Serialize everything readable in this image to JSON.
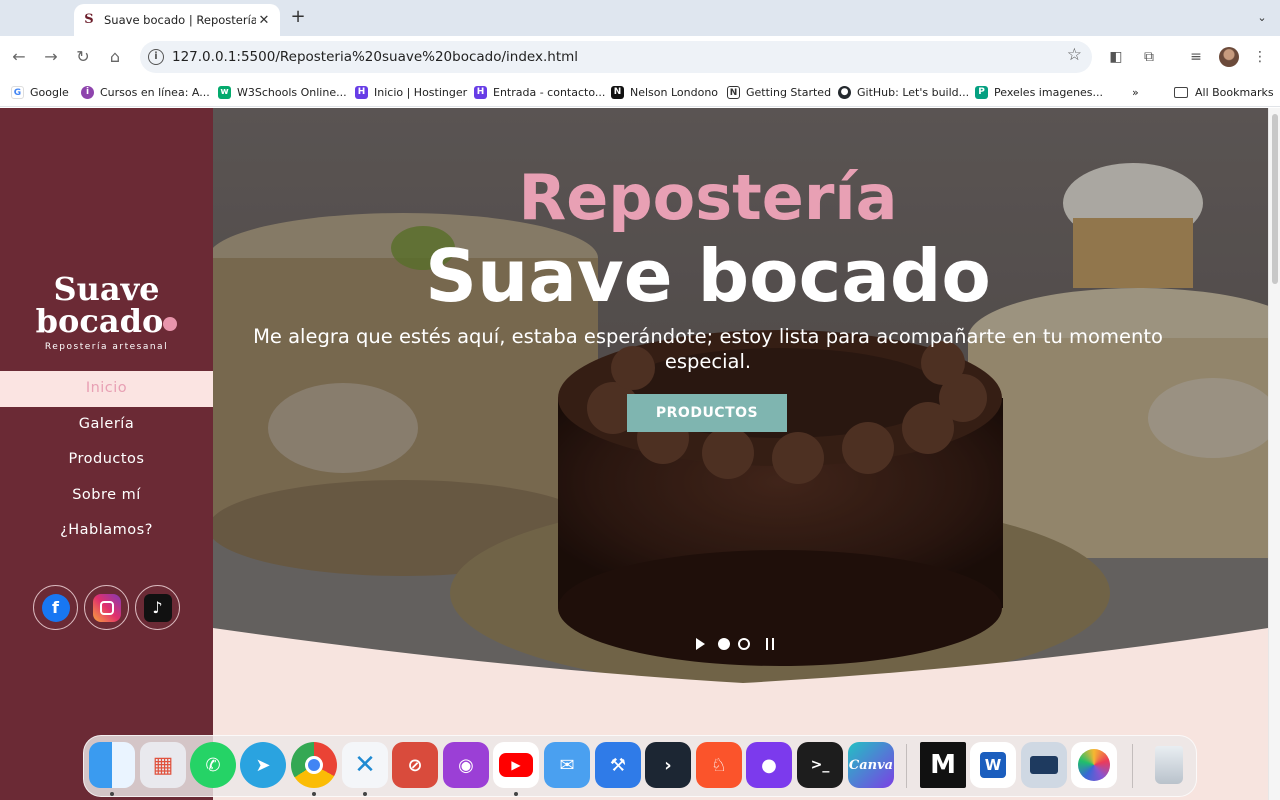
{
  "browser": {
    "tab_title": "Suave bocado | Repostería ar",
    "tab_favicon_letter": "S",
    "url": "127.0.0.1:5500/Reposteria%20suave%20bocado/index.html",
    "bookmarks": [
      {
        "label": "Google",
        "icon": "google-icon",
        "color": "#4285f4"
      },
      {
        "label": "Cursos en línea: A...",
        "icon": "cursos-icon",
        "color": "#8e44ad"
      },
      {
        "label": "W3Schools Online...",
        "icon": "w3schools-icon",
        "color": "#04aa6d"
      },
      {
        "label": "Inicio | Hostinger",
        "icon": "hostinger-icon",
        "color": "#673de6"
      },
      {
        "label": "Entrada - contacto...",
        "icon": "hostinger-mail-icon",
        "color": "#673de6"
      },
      {
        "label": "Nelson Londono",
        "icon": "nelson-icon",
        "color": "#111111"
      },
      {
        "label": "Getting Started",
        "icon": "notion-icon",
        "color": "#333333"
      },
      {
        "label": "GitHub: Let's build...",
        "icon": "github-icon",
        "color": "#24292e"
      },
      {
        "label": "Pexeles imagenes...",
        "icon": "pexels-icon",
        "color": "#05a081"
      }
    ],
    "all_bookmarks": "All Bookmarks"
  },
  "sidebar": {
    "logo_line1": "Suave",
    "logo_line2": "bocad",
    "logo_line2_end": "o",
    "logo_tagline": "Repostería artesanal",
    "nav": [
      {
        "label": "Inicio",
        "active": true
      },
      {
        "label": "Galería"
      },
      {
        "label": "Productos"
      },
      {
        "label": "Sobre mí"
      },
      {
        "label": "¿Hablamos?"
      }
    ],
    "social": [
      "facebook-icon",
      "instagram-icon",
      "tiktok-icon"
    ]
  },
  "hero": {
    "title_pink": "Repostería",
    "title_white": "Suave bocado",
    "subtitle": "Me alegra que estés aquí, estaba esperándote; estoy lista para acompañarte en tu momento especial.",
    "button": "PRODUCTOS",
    "slides": 2,
    "active_slide": 1
  },
  "colors": {
    "sidebar": "#6b2a35",
    "accent_pink": "#e8a0b4",
    "button_teal": "#7fb5b0",
    "active_nav_bg": "#fbe4e2"
  },
  "dock": [
    "finder-icon",
    "launchpad-icon",
    "whatsapp-icon",
    "telegram-icon",
    "chrome-icon",
    "vscode-icon",
    "safari-icon",
    "podcasts-icon",
    "youtube-icon",
    "mail-icon",
    "xcode-icon",
    "remote-desktop-icon",
    "brave-icon",
    "github-desktop-icon",
    "terminal-icon",
    "canva-icon",
    "mindnode-icon",
    "word-icon",
    "preview-icon",
    "photos-icon",
    "trash-icon"
  ],
  "dock_texts": {
    "canva": "Canva",
    "word": "W"
  }
}
